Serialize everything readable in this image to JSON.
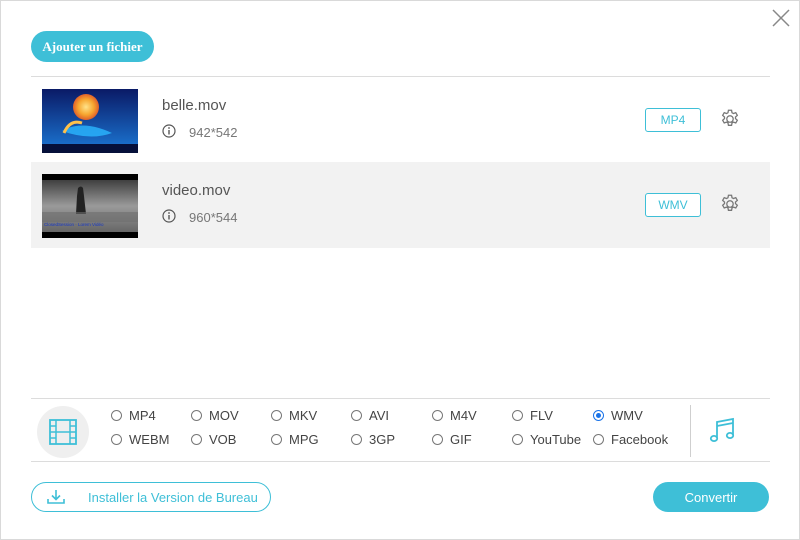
{
  "header": {
    "add_file_label": "Ajouter un fichier"
  },
  "files": [
    {
      "name": "belle.mov",
      "resolution": "942*542",
      "format": "MP4"
    },
    {
      "name": "video.mov",
      "resolution": "960*544",
      "format": "WMV",
      "thumb_caption": "ClosedSession · Lorem Vidéo"
    }
  ],
  "formats": {
    "row1": [
      "MP4",
      "MOV",
      "MKV",
      "AVI",
      "M4V",
      "FLV",
      "WMV"
    ],
    "row2": [
      "WEBM",
      "VOB",
      "MPG",
      "3GP",
      "GIF",
      "YouTube",
      "Facebook"
    ],
    "selected": "WMV"
  },
  "footer": {
    "install_label": "Installer la Version de Bureau",
    "convert_label": "Convertir"
  },
  "colors": {
    "accent": "#3ebfd7",
    "radio_selected": "#1a73e8"
  },
  "icons": [
    "close-icon",
    "info-icon",
    "gear-icon",
    "film-icon",
    "music-note-icon",
    "download-icon"
  ]
}
